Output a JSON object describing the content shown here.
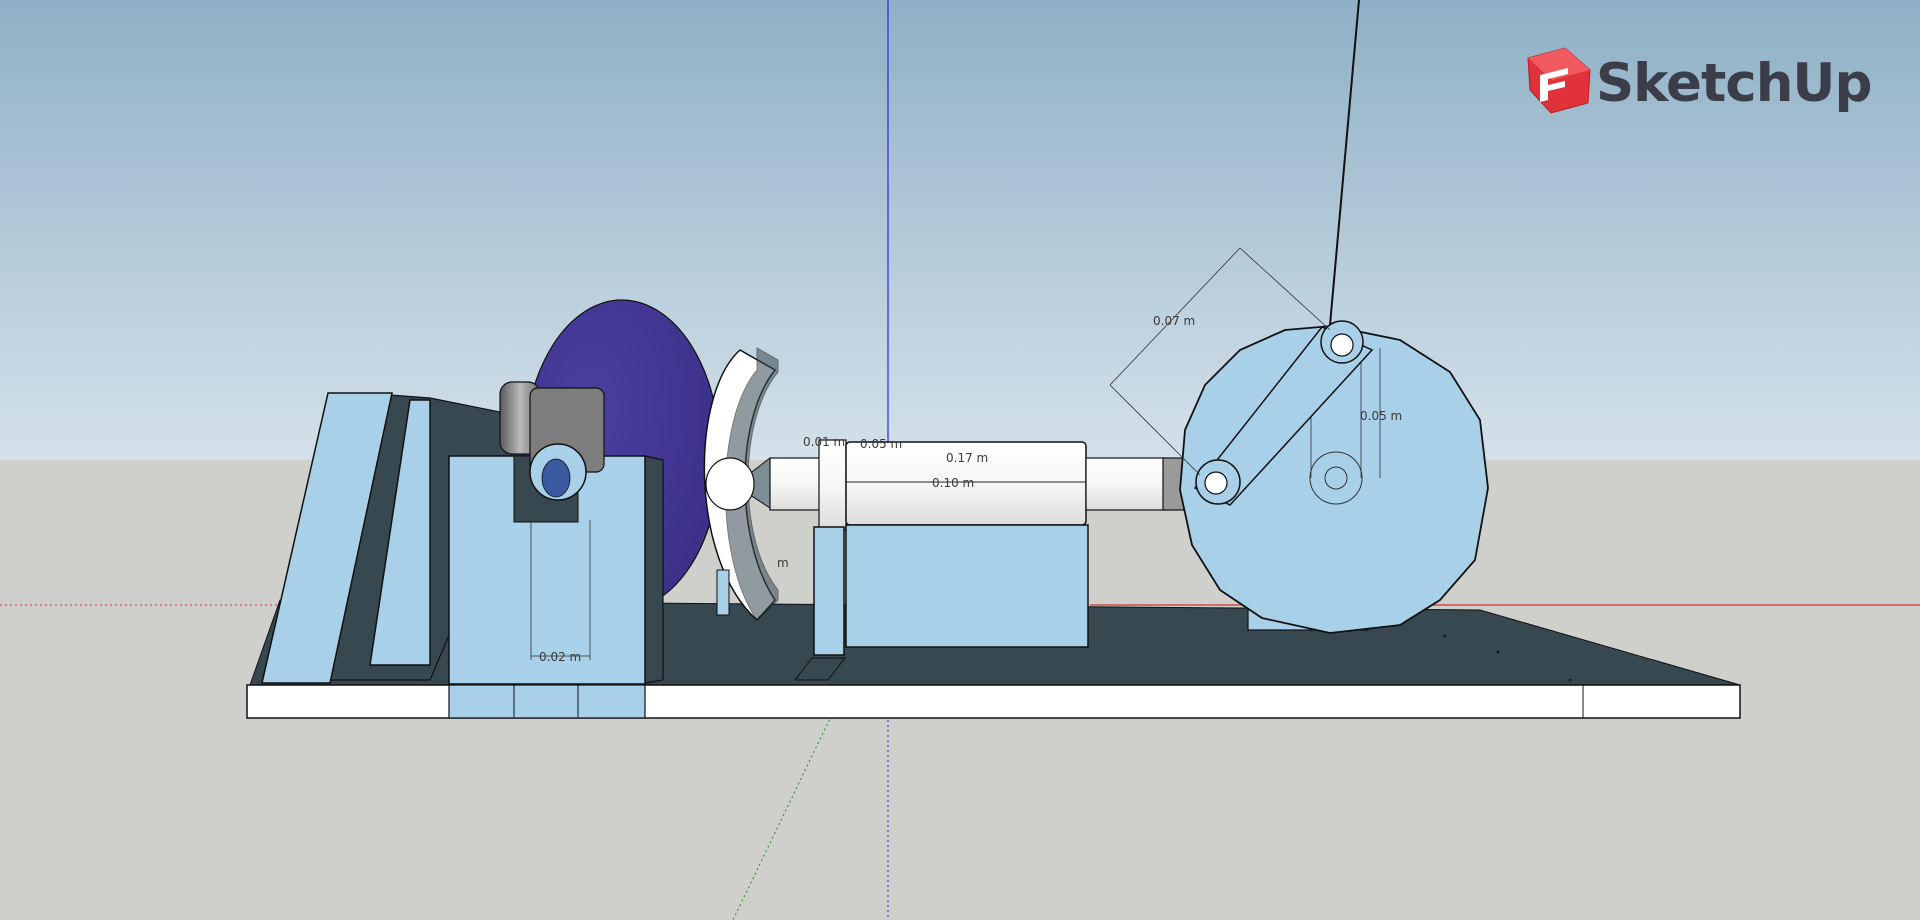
{
  "app": {
    "logo_text": "SketchUp",
    "logo_mark_color": "#e0323a",
    "logo_text_color": "#3b3e49"
  },
  "scene": {
    "sky_top_color": "#8fb0c6",
    "sky_bottom_color": "#d4e1ea",
    "ground_color": "#cfcfcb",
    "part_fill_color": "#a8d0e8",
    "shadow_color": "#374851",
    "sphere_color": "#3b2f86",
    "axis_blue": "#2a2ad0",
    "axis_red": "#d03030",
    "axis_green": "#2a8a2a"
  },
  "dimensions": {
    "d_top_arm": "0.07 m",
    "d_flywheel_offset": "0.05 m",
    "d_shaft_length": "0.17 m",
    "d_shaft_inner": "0.10 m",
    "d_small_a": "0.01 m",
    "d_small_b": "0.05 m",
    "d_bracket": "0.02 m",
    "d_partial": "m"
  }
}
